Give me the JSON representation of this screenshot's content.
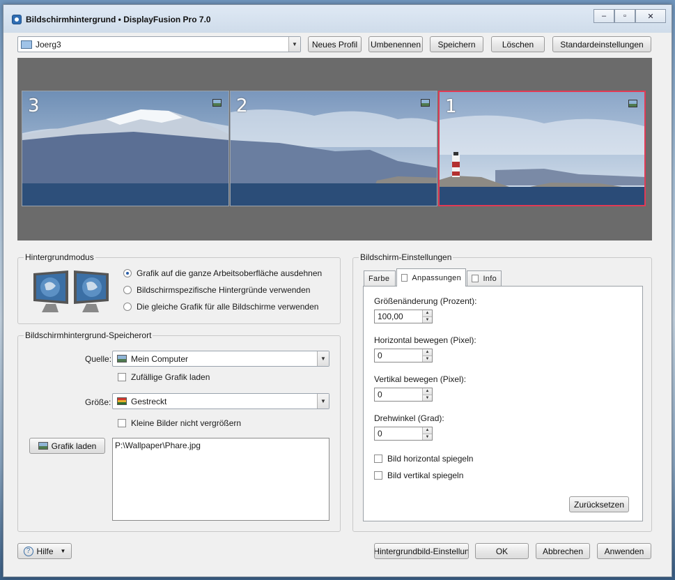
{
  "window": {
    "title": "Bildschirmhintergrund • DisplayFusion Pro 7.0",
    "controls": [
      "–",
      "▫",
      "✕"
    ]
  },
  "profile": {
    "selected": "Joerg3",
    "buttons": {
      "new": "Neues Profil",
      "rename": "Umbenennen",
      "save": "Speichern",
      "delete": "Löschen",
      "defaults": "Standardeinstellungen"
    }
  },
  "preview": {
    "screens": [
      {
        "number": "3",
        "icon": "image-icon",
        "selected": false
      },
      {
        "number": "2",
        "icon": "image-icon",
        "selected": false
      },
      {
        "number": "1",
        "icon": "image-icon",
        "selected": true
      }
    ],
    "selection_color": "#e23a55"
  },
  "mode_group": {
    "title": "Hintergrundmodus",
    "options": [
      {
        "label": "Grafik auf die ganze Arbeitsoberfläche ausdehnen",
        "selected": true
      },
      {
        "label": "Bildschirmspezifische Hintergründe verwenden",
        "selected": false
      },
      {
        "label": "Die gleiche Grafik für alle Bildschirme verwenden",
        "selected": false
      }
    ]
  },
  "location_group": {
    "title": "Bildschirmhintergrund-Speicherort",
    "source_label": "Quelle:",
    "source_value": "Mein Computer",
    "random_label": "Zufällige Grafik laden",
    "size_label": "Größe:",
    "size_value": "Gestreckt",
    "no_enlarge_label": "Kleine Bilder nicht vergrößern",
    "load_button": "Grafik laden",
    "path": "P:\\Wallpaper\\Phare.jpg"
  },
  "screen_settings": {
    "title": "Bildschirm-Einstellungen",
    "tabs": [
      {
        "label": "Farbe",
        "active": false,
        "has_check": false
      },
      {
        "label": "Anpassungen",
        "active": true,
        "has_check": true
      },
      {
        "label": "Info",
        "active": false,
        "has_check": true
      }
    ],
    "resize_label": "Größenänderung (Prozent):",
    "resize_value": "100,00",
    "hmove_label": "Horizontal bewegen (Pixel):",
    "hmove_value": "0",
    "vmove_label": "Vertikal bewegen (Pixel):",
    "vmove_value": "0",
    "rotate_label": "Drehwinkel (Grad):",
    "rotate_value": "0",
    "flip_h_label": "Bild horizontal spiegeln",
    "flip_v_label": "Bild vertikal spiegeln",
    "reset_button": "Zurücksetzen"
  },
  "footer": {
    "help": "Hilfe",
    "wallpaper_settings": "Hintergrundbild-Einstellun",
    "ok": "OK",
    "cancel": "Abbrechen",
    "apply": "Anwenden"
  }
}
